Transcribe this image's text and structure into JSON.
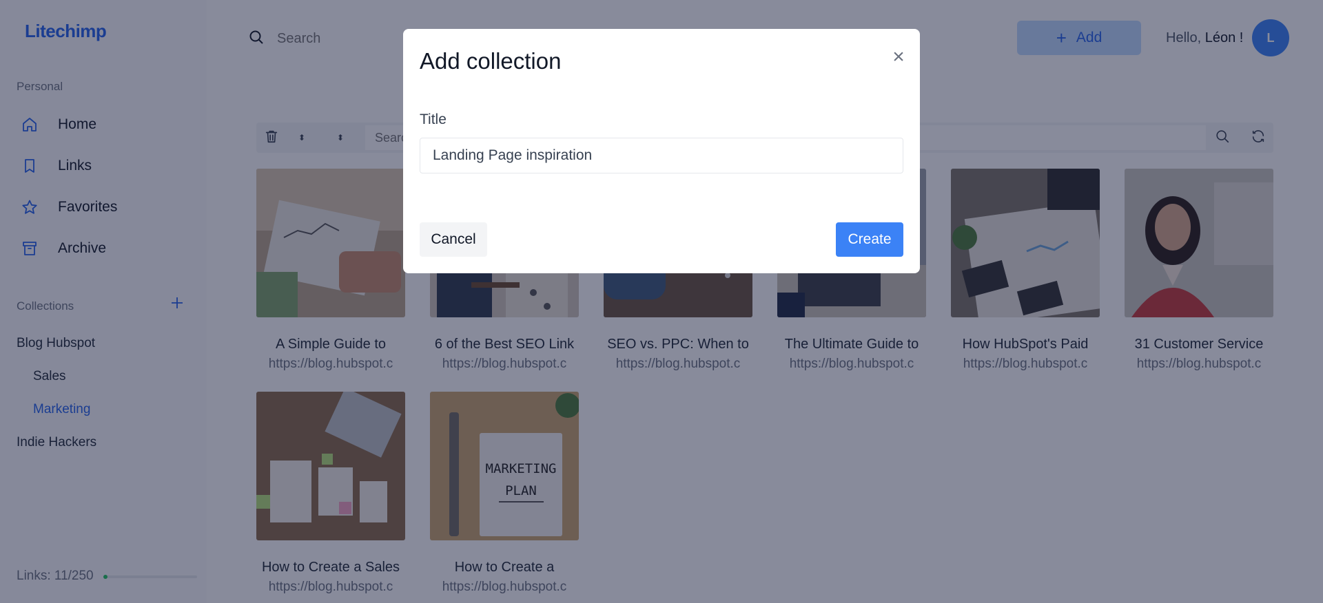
{
  "app": {
    "logo": "Litechimp"
  },
  "sidebar": {
    "personal_label": "Personal",
    "nav": [
      {
        "label": "Home",
        "icon": "home-icon"
      },
      {
        "label": "Links",
        "icon": "bookmark-icon"
      },
      {
        "label": "Favorites",
        "icon": "star-icon"
      },
      {
        "label": "Archive",
        "icon": "archive-icon"
      }
    ],
    "collections_label": "Collections",
    "collections": [
      {
        "label": "Blog Hubspot"
      },
      {
        "label": "Sales"
      },
      {
        "label": "Marketing",
        "active": true
      },
      {
        "label": "Indie Hackers"
      }
    ],
    "links_count": "Links: 11/250",
    "links_usage": 0.044
  },
  "header": {
    "search_placeholder": "Search",
    "add_label": "Add",
    "hello_prefix": "Hello,",
    "user_name": "Léon !",
    "avatar_initial": "L"
  },
  "toolbar": {
    "search_placeholder": "Search"
  },
  "cards": [
    {
      "title": "A Simple Guide to",
      "url": "https://blog.hubspot.c"
    },
    {
      "title": "6 of the Best SEO Link",
      "url": "https://blog.hubspot.c"
    },
    {
      "title": "SEO vs. PPC: When to",
      "url": "https://blog.hubspot.c"
    },
    {
      "title": "The Ultimate Guide to",
      "url": "https://blog.hubspot.c"
    },
    {
      "title": "How HubSpot's Paid",
      "url": "https://blog.hubspot.c"
    },
    {
      "title": "31 Customer Service",
      "url": "https://blog.hubspot.c"
    },
    {
      "title": "How to Create a Sales",
      "url": "https://blog.hubspot.c"
    },
    {
      "title": "How to Create a",
      "url": "https://blog.hubspot.c"
    }
  ],
  "thumbnail_art": {
    "marketing_plan_text_line1": "MARKETING",
    "marketing_plan_text_line2": "PLAN"
  },
  "modal": {
    "title": "Add collection",
    "close_symbol": "×",
    "field_label": "Title",
    "field_value": "Landing Page inspiration",
    "cancel_label": "Cancel",
    "create_label": "Create"
  },
  "colors": {
    "accent": "#2563eb",
    "overlay": "rgba(17,24,55,0.5)",
    "create_button": "#3b82f6"
  }
}
